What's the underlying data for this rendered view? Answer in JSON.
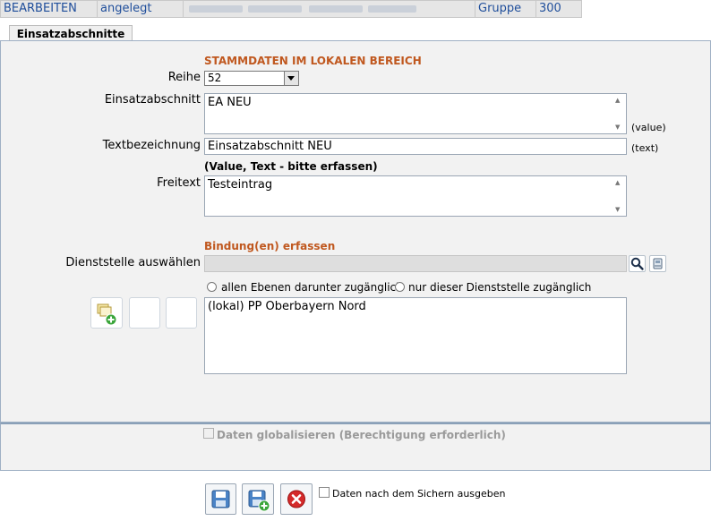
{
  "topbar": {
    "mode": "BEARBEITEN",
    "status": "angelegt",
    "group_label": "Gruppe",
    "group_value": "300"
  },
  "tabs": {
    "active": "Einsatzabschnitte"
  },
  "form": {
    "section_title": "STAMMDATEN IM LOKALEN BEREICH",
    "row_label": "Reihe",
    "row_value": "52",
    "einsatzabschnitt_label": "Einsatzabschnitt",
    "einsatzabschnitt_value": "EA NEU",
    "value_hint": "(value)",
    "textbezeichnung_label": "Textbezeichnung",
    "textbezeichnung_value": "Einsatzabschnitt NEU",
    "text_hint": "(text)",
    "required_note": "(Value, Text - bitte erfassen)",
    "freitext_label": "Freitext",
    "freitext_value": "Testeintrag"
  },
  "binding": {
    "title": "Bindung(en) erfassen",
    "dienststelle_label": "Dienststelle auswählen",
    "radio_all": "allen Ebenen darunter zugänglich",
    "radio_only": "nur dieser Dienststelle zugänglich",
    "list_items": [
      "(lokal) PP Oberbayern Nord"
    ]
  },
  "global": {
    "checkbox_label": "Daten globalisieren (Berechtigung erforderlich)"
  },
  "footer": {
    "output_checkbox_label": "Daten nach dem Sichern ausgeben"
  },
  "colors": {
    "section_title": "#c0581f",
    "topbar_text": "#1f4e9b",
    "panel_bg": "#f2f2f2"
  }
}
